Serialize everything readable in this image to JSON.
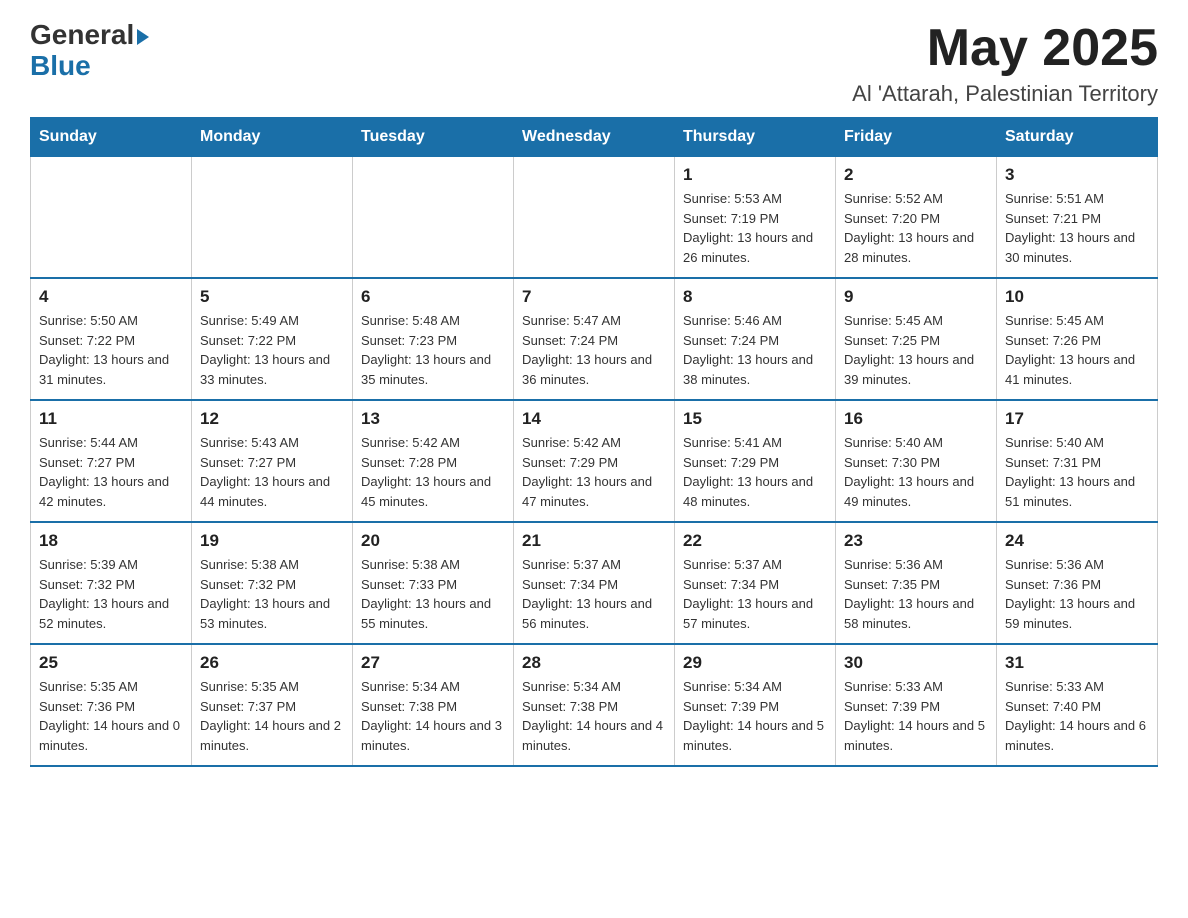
{
  "header": {
    "logo_general": "General",
    "logo_blue": "Blue",
    "month_title": "May 2025",
    "location": "Al 'Attarah, Palestinian Territory"
  },
  "days_of_week": [
    "Sunday",
    "Monday",
    "Tuesday",
    "Wednesday",
    "Thursday",
    "Friday",
    "Saturday"
  ],
  "weeks": [
    [
      {
        "day": "",
        "info": ""
      },
      {
        "day": "",
        "info": ""
      },
      {
        "day": "",
        "info": ""
      },
      {
        "day": "",
        "info": ""
      },
      {
        "day": "1",
        "info": "Sunrise: 5:53 AM\nSunset: 7:19 PM\nDaylight: 13 hours and 26 minutes."
      },
      {
        "day": "2",
        "info": "Sunrise: 5:52 AM\nSunset: 7:20 PM\nDaylight: 13 hours and 28 minutes."
      },
      {
        "day": "3",
        "info": "Sunrise: 5:51 AM\nSunset: 7:21 PM\nDaylight: 13 hours and 30 minutes."
      }
    ],
    [
      {
        "day": "4",
        "info": "Sunrise: 5:50 AM\nSunset: 7:22 PM\nDaylight: 13 hours and 31 minutes."
      },
      {
        "day": "5",
        "info": "Sunrise: 5:49 AM\nSunset: 7:22 PM\nDaylight: 13 hours and 33 minutes."
      },
      {
        "day": "6",
        "info": "Sunrise: 5:48 AM\nSunset: 7:23 PM\nDaylight: 13 hours and 35 minutes."
      },
      {
        "day": "7",
        "info": "Sunrise: 5:47 AM\nSunset: 7:24 PM\nDaylight: 13 hours and 36 minutes."
      },
      {
        "day": "8",
        "info": "Sunrise: 5:46 AM\nSunset: 7:24 PM\nDaylight: 13 hours and 38 minutes."
      },
      {
        "day": "9",
        "info": "Sunrise: 5:45 AM\nSunset: 7:25 PM\nDaylight: 13 hours and 39 minutes."
      },
      {
        "day": "10",
        "info": "Sunrise: 5:45 AM\nSunset: 7:26 PM\nDaylight: 13 hours and 41 minutes."
      }
    ],
    [
      {
        "day": "11",
        "info": "Sunrise: 5:44 AM\nSunset: 7:27 PM\nDaylight: 13 hours and 42 minutes."
      },
      {
        "day": "12",
        "info": "Sunrise: 5:43 AM\nSunset: 7:27 PM\nDaylight: 13 hours and 44 minutes."
      },
      {
        "day": "13",
        "info": "Sunrise: 5:42 AM\nSunset: 7:28 PM\nDaylight: 13 hours and 45 minutes."
      },
      {
        "day": "14",
        "info": "Sunrise: 5:42 AM\nSunset: 7:29 PM\nDaylight: 13 hours and 47 minutes."
      },
      {
        "day": "15",
        "info": "Sunrise: 5:41 AM\nSunset: 7:29 PM\nDaylight: 13 hours and 48 minutes."
      },
      {
        "day": "16",
        "info": "Sunrise: 5:40 AM\nSunset: 7:30 PM\nDaylight: 13 hours and 49 minutes."
      },
      {
        "day": "17",
        "info": "Sunrise: 5:40 AM\nSunset: 7:31 PM\nDaylight: 13 hours and 51 minutes."
      }
    ],
    [
      {
        "day": "18",
        "info": "Sunrise: 5:39 AM\nSunset: 7:32 PM\nDaylight: 13 hours and 52 minutes."
      },
      {
        "day": "19",
        "info": "Sunrise: 5:38 AM\nSunset: 7:32 PM\nDaylight: 13 hours and 53 minutes."
      },
      {
        "day": "20",
        "info": "Sunrise: 5:38 AM\nSunset: 7:33 PM\nDaylight: 13 hours and 55 minutes."
      },
      {
        "day": "21",
        "info": "Sunrise: 5:37 AM\nSunset: 7:34 PM\nDaylight: 13 hours and 56 minutes."
      },
      {
        "day": "22",
        "info": "Sunrise: 5:37 AM\nSunset: 7:34 PM\nDaylight: 13 hours and 57 minutes."
      },
      {
        "day": "23",
        "info": "Sunrise: 5:36 AM\nSunset: 7:35 PM\nDaylight: 13 hours and 58 minutes."
      },
      {
        "day": "24",
        "info": "Sunrise: 5:36 AM\nSunset: 7:36 PM\nDaylight: 13 hours and 59 minutes."
      }
    ],
    [
      {
        "day": "25",
        "info": "Sunrise: 5:35 AM\nSunset: 7:36 PM\nDaylight: 14 hours and 0 minutes."
      },
      {
        "day": "26",
        "info": "Sunrise: 5:35 AM\nSunset: 7:37 PM\nDaylight: 14 hours and 2 minutes."
      },
      {
        "day": "27",
        "info": "Sunrise: 5:34 AM\nSunset: 7:38 PM\nDaylight: 14 hours and 3 minutes."
      },
      {
        "day": "28",
        "info": "Sunrise: 5:34 AM\nSunset: 7:38 PM\nDaylight: 14 hours and 4 minutes."
      },
      {
        "day": "29",
        "info": "Sunrise: 5:34 AM\nSunset: 7:39 PM\nDaylight: 14 hours and 5 minutes."
      },
      {
        "day": "30",
        "info": "Sunrise: 5:33 AM\nSunset: 7:39 PM\nDaylight: 14 hours and 5 minutes."
      },
      {
        "day": "31",
        "info": "Sunrise: 5:33 AM\nSunset: 7:40 PM\nDaylight: 14 hours and 6 minutes."
      }
    ]
  ]
}
